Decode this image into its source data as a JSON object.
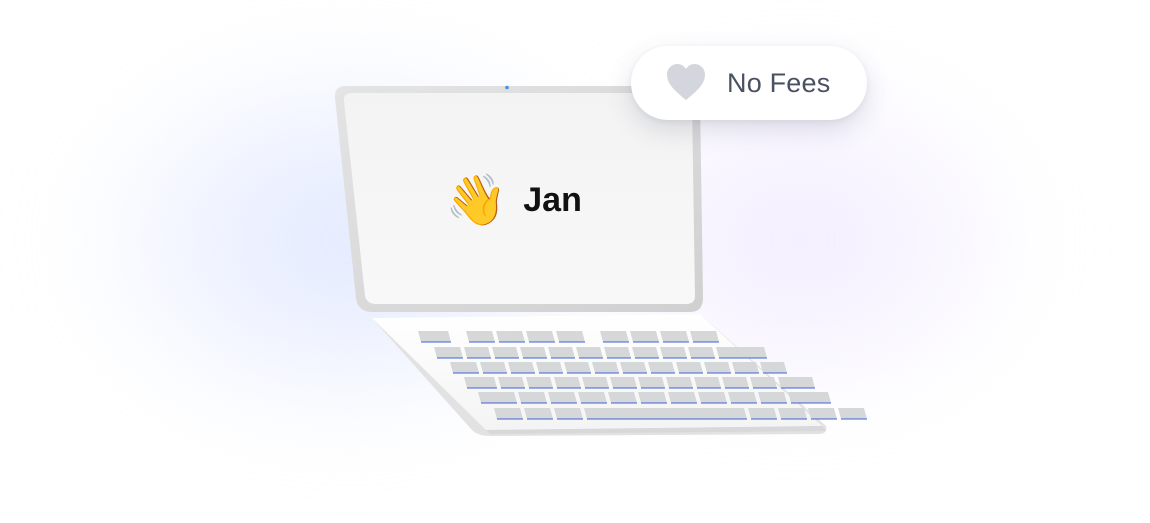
{
  "greeting": {
    "emoji": "👋",
    "name": "Jan"
  },
  "badge": {
    "icon": "heart-icon",
    "label": "No Fees"
  },
  "colors": {
    "heart": "#d3d6dc",
    "badge_text": "#4a5261",
    "key_fill": "#d6d7d9",
    "key_accent": "#3f63d9",
    "screen": "#f5f5f5"
  }
}
